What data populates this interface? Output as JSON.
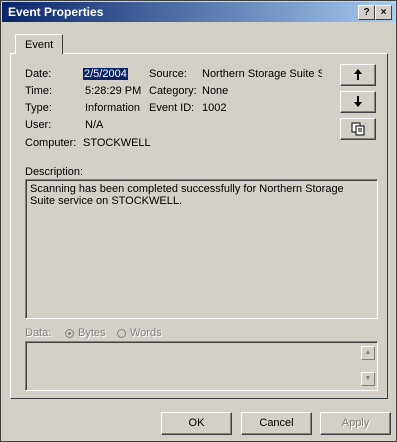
{
  "window": {
    "title": "Event Properties",
    "help_btn": "?",
    "close_btn": "×"
  },
  "tabs": [
    {
      "label": "Event"
    }
  ],
  "fields": {
    "date_label": "Date:",
    "date_value": "2/5/2004",
    "time_label": "Time:",
    "time_value": "5:28:29 PM",
    "type_label": "Type:",
    "type_value": "Information",
    "user_label": "User:",
    "user_value": "N/A",
    "computer_label": "Computer:",
    "computer_value": "STOCKWELL",
    "source_label": "Source:",
    "source_value": "Northern Storage Suite Se",
    "category_label": "Category:",
    "category_value": "None",
    "eventid_label": "Event ID:",
    "eventid_value": "1002"
  },
  "nav_buttons": {
    "up_icon": "up-arrow-icon",
    "down_icon": "down-arrow-icon",
    "copy_icon": "copy-icon"
  },
  "description": {
    "label": "Description:",
    "text": "Scanning has been completed successfully for Northern Storage Suite service on STOCKWELL."
  },
  "data_section": {
    "label": "Data:",
    "bytes_label": "Bytes",
    "words_label": "Words",
    "selected": "Bytes"
  },
  "footer": {
    "ok": "OK",
    "cancel": "Cancel",
    "apply": "Apply"
  }
}
